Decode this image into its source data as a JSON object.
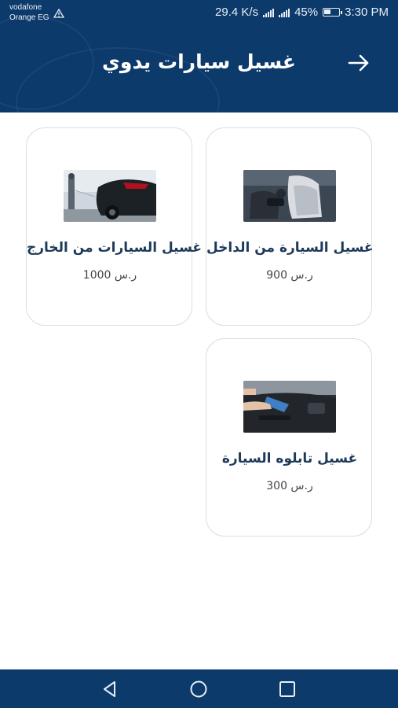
{
  "status_bar": {
    "carrier_line1": "vodafone",
    "carrier_line2": "Orange EG",
    "speed": "29.4 K/s",
    "battery": "45%",
    "time": "3:30 PM"
  },
  "header": {
    "title": "غسيل سيارات يدوي"
  },
  "services": [
    {
      "name": "غسيل السيارة من الداخل",
      "price": "900 ر.س"
    },
    {
      "name": "غسيل السيارات من الخارج",
      "price": "1000 ر.س"
    },
    {
      "name": "غسيل تابلوه السيارة",
      "price": "300 ر.س"
    }
  ],
  "colors": {
    "primary": "#0c3a6b",
    "card_border": "#d8dde3",
    "title_text": "#1d3a5a"
  },
  "icons": {
    "back": "arrow-right-icon",
    "nav_back": "triangle-back-icon",
    "nav_home": "circle-home-icon",
    "nav_recent": "square-recent-icon"
  }
}
